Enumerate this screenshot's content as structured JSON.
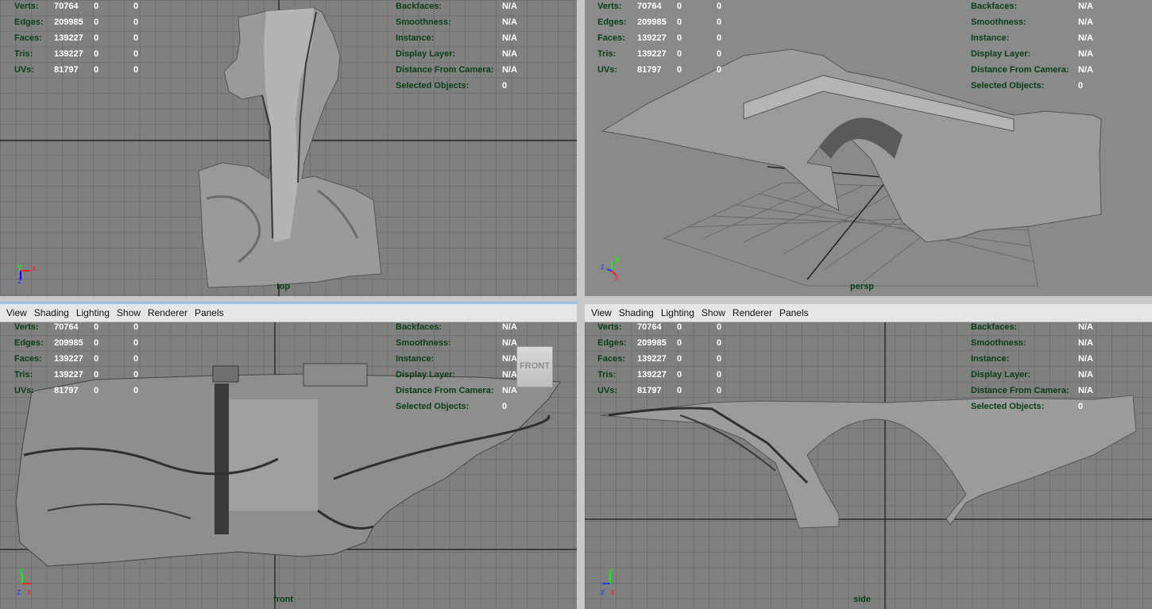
{
  "stats": {
    "verts": {
      "label": "Verts:",
      "v1": "70764",
      "v2": "0",
      "v3": "0"
    },
    "edges": {
      "label": "Edges:",
      "v1": "209985",
      "v2": "0",
      "v3": "0"
    },
    "faces": {
      "label": "Faces:",
      "v1": "139227",
      "v2": "0",
      "v3": "0"
    },
    "tris": {
      "label": "Tris:",
      "v1": "139227",
      "v2": "0",
      "v3": "0"
    },
    "uvs": {
      "label": "UVs:",
      "v1": "81797",
      "v2": "0",
      "v3": "0"
    }
  },
  "props": {
    "backfaces": {
      "label": "Backfaces:",
      "value": "N/A"
    },
    "smoothness": {
      "label": "Smoothness:",
      "value": "N/A"
    },
    "instance": {
      "label": "Instance:",
      "value": "N/A"
    },
    "display_layer": {
      "label": "Display Layer:",
      "value": "N/A"
    },
    "distance": {
      "label": "Distance From Camera:",
      "value": "N/A"
    },
    "selected": {
      "label": "Selected Objects:",
      "value": "0"
    }
  },
  "menu": {
    "view": "View",
    "shading": "Shading",
    "lighting": "Lighting",
    "show": "Show",
    "renderer": "Renderer",
    "panels": "Panels"
  },
  "viewports": {
    "top": {
      "camera": "top"
    },
    "persp": {
      "camera": "persp"
    },
    "front": {
      "camera": "front"
    },
    "side": {
      "camera": "side"
    }
  },
  "view_cube": {
    "label": "FRONT"
  },
  "axis_letters": {
    "x": "x",
    "y": "y",
    "z": "z"
  },
  "colors": {
    "hud_key": "#073f16",
    "hud_value": "#ffffff",
    "grid": "#6f6f6f",
    "viewport_bg": "#808080",
    "active_border": "#9ac0e4"
  }
}
